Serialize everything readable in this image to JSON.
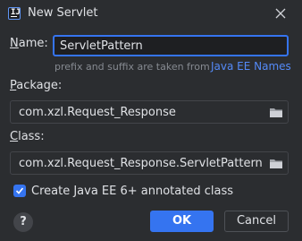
{
  "window": {
    "title": "New Servlet",
    "app_icon": "intellij-idea-icon",
    "close_icon": "close-icon"
  },
  "form": {
    "name": {
      "label_mnemonic": "N",
      "label_rest": "ame:",
      "value": "ServletPattern",
      "hint": "prefix and suffix are taken from",
      "hint_link": "Java EE Names"
    },
    "package": {
      "label_mnemonic": "P",
      "label_rest": "ackage:",
      "value": "com.xzl.Request_Response",
      "browse_icon": "folder-icon"
    },
    "class": {
      "label_mnemonic": "C",
      "label_rest": "lass:",
      "value": "com.xzl.Request_Response.ServletPattern",
      "browse_icon": "folder-icon"
    },
    "annotated": {
      "checked": true,
      "label": "Create Java EE 6+ annotated class"
    }
  },
  "footer": {
    "help_label": "?",
    "ok_label": "OK",
    "cancel_label": "Cancel"
  },
  "colors": {
    "background": "#2b2d30",
    "accent": "#3574f0",
    "link": "#548af7",
    "text": "#dfe1e5",
    "muted_text": "#868a91"
  }
}
